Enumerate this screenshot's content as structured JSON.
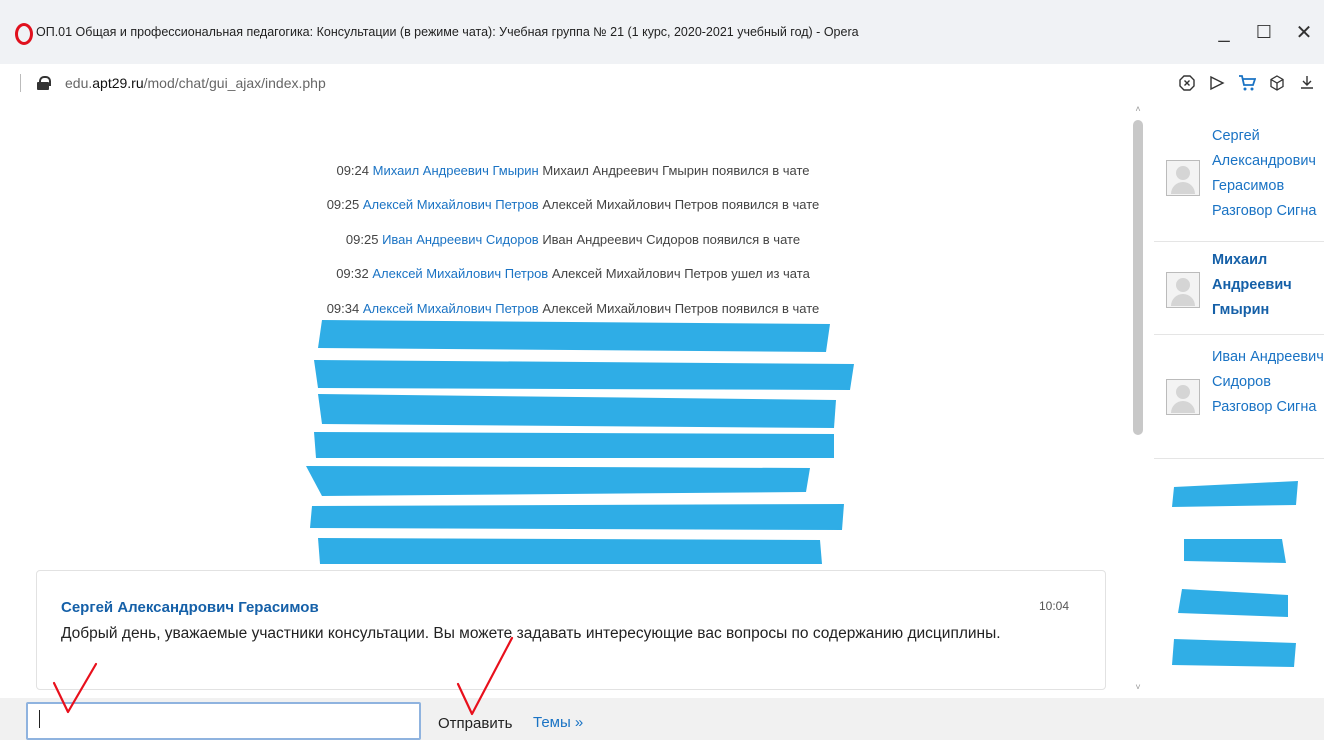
{
  "window": {
    "title": "ОП.01 Общая и профессиональная педагогика: Консультации (в режиме чата): Учебная группа № 21 (1 курс, 2020-2021 учебный год) - Opera",
    "minimize": "_",
    "maximize": "☐",
    "close": "✕"
  },
  "address": {
    "prefix": "edu.",
    "domain": "apt29.ru",
    "path": "/mod/chat/gui_ajax/index.php"
  },
  "system_messages": [
    {
      "time": "09:24",
      "name": "Михаил Андреевич Гмырин",
      "text": " Михаил Андреевич Гмырин появился в чате"
    },
    {
      "time": "09:25",
      "name": "Алексей Михайлович Петров",
      "text": " Алексей Михайлович Петров появился в чате"
    },
    {
      "time": "09:25",
      "name": "Иван Андреевич Сидоров",
      "text": " Иван Андреевич Сидоров появился в чате"
    },
    {
      "time": "09:32",
      "name": "Алексей Михайлович Петров",
      "text": " Алексей Михайлович Петров ушел из чата"
    },
    {
      "time": "09:34",
      "name": "Алексей Михайлович Петров",
      "text": " Алексей Михайлович Петров появился в чате"
    }
  ],
  "message": {
    "author": "Сергей Александрович Герасимов",
    "time": "10:04",
    "text": "Добрый день, уважаемые участники консультации. Вы можете задавать интересующие вас вопросы по содержанию дисциплины."
  },
  "users": [
    {
      "name": "Сергей Александрович Герасимов Разговор Сигна"
    },
    {
      "name": "Михаил Андреевич Гмырин"
    },
    {
      "name": "Иван Андреевич Сидоров Разговор Сигна"
    }
  ],
  "input": {
    "value": "",
    "send_label": "Отправить",
    "themes_label": "Темы »"
  },
  "colors": {
    "link": "#1a73c4",
    "redaction": "#1ea7e4",
    "annotation": "#e8101c"
  }
}
